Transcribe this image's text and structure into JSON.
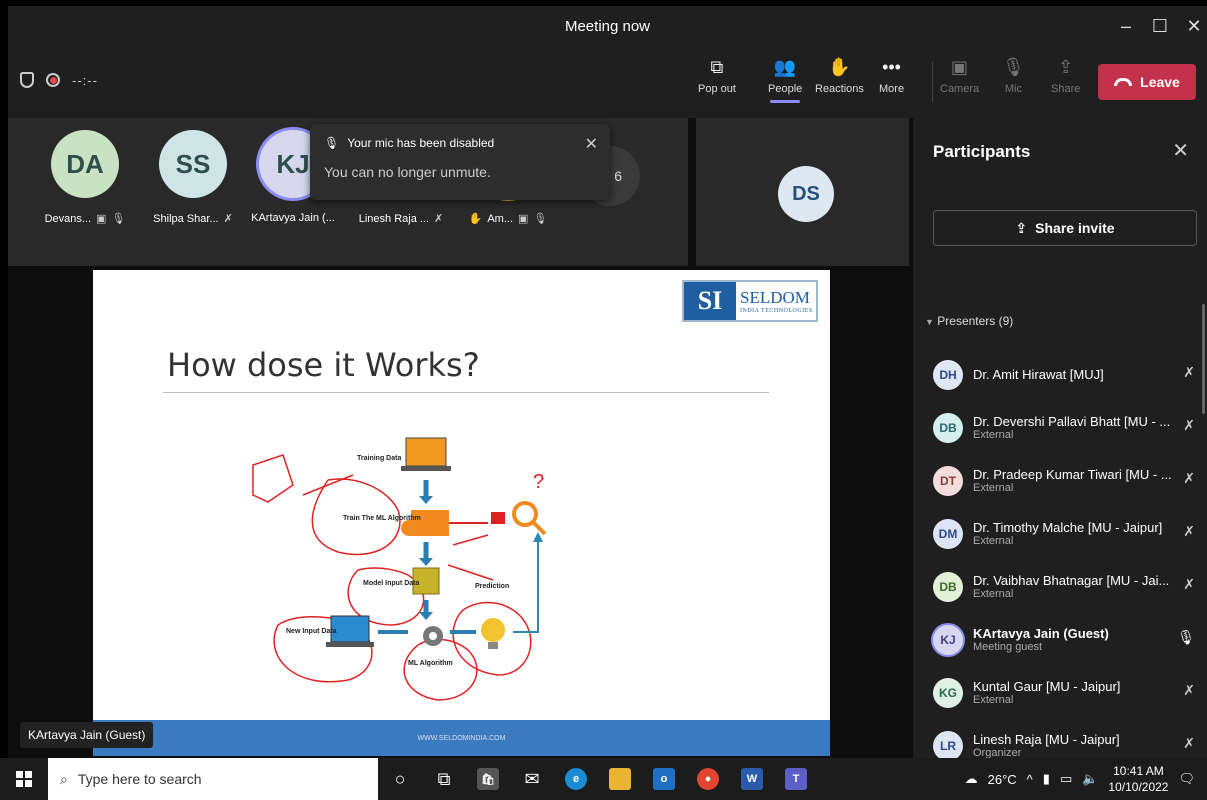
{
  "window": {
    "title": "Meeting now"
  },
  "toolbar": {
    "timer": "--:--",
    "popout": "Pop out",
    "people": "People",
    "reactions": "Reactions",
    "more": "More",
    "camera": "Camera",
    "mic": "Mic",
    "share": "Share",
    "leave": "Leave"
  },
  "toast": {
    "title": "Your mic has been disabled",
    "message": "You can no longer unmute."
  },
  "gallery": {
    "tiles": [
      {
        "initials": "DA",
        "name": "Devans...",
        "color": "#c9e2c2"
      },
      {
        "initials": "SS",
        "name": "Shilpa Shar...",
        "color": "#cfe5e5"
      },
      {
        "initials": "KJ",
        "name": "KArtavya Jain (...",
        "color": "#d7d8f0"
      },
      {
        "initials": "",
        "name": "Linesh Raja ...",
        "color": "#d9e3ee"
      },
      {
        "initials": "",
        "name": "Am...",
        "color": "#f3d89a"
      }
    ],
    "overflow": "6",
    "featured": {
      "initials": "DS"
    }
  },
  "slide": {
    "logo_mark": "SI",
    "logo_name": "SELDOM",
    "logo_sub": "INDIA TECHNOLOGIES",
    "heading": "How dose it Works?",
    "diagram": {
      "training_data": "Training Data",
      "train_ml": "Train The ML Algorithm",
      "model_input": "Model Input Data",
      "prediction": "Prediction",
      "new_input": "New Input Data",
      "ml_algorithm": "ML Algorithm",
      "question": "?"
    },
    "footer": "WWW.SELDOMINDIA.COM"
  },
  "speaker_label": "KArtavya Jain (Guest)",
  "panel": {
    "title": "Participants",
    "share_invite": "Share invite",
    "presenters_label": "Presenters (9)",
    "participants": [
      {
        "initials": "DH",
        "name": "Dr. Amit Hirawat [MUJ]",
        "sub": "",
        "bg": "#dfe6f5",
        "fg": "#2b4b8c",
        "mic": "muted"
      },
      {
        "initials": "DB",
        "name": "Dr. Devershi Pallavi Bhatt [MU - ...",
        "sub": "External",
        "bg": "#d5eeee",
        "fg": "#2a6a6a",
        "mic": "muted"
      },
      {
        "initials": "DT",
        "name": "Dr. Pradeep Kumar Tiwari [MU - ...",
        "sub": "External",
        "bg": "#f2dcdc",
        "fg": "#8a3a3a",
        "mic": "muted"
      },
      {
        "initials": "DM",
        "name": "Dr. Timothy Malche [MU - Jaipur]",
        "sub": "External",
        "bg": "#dde4f6",
        "fg": "#2b4b8c",
        "mic": "muted"
      },
      {
        "initials": "DB",
        "name": "Dr. Vaibhav Bhatnagar [MU - Jai...",
        "sub": "External",
        "bg": "#e2efd9",
        "fg": "#3d6a2a",
        "mic": "muted"
      },
      {
        "initials": "KJ",
        "name": "KArtavya Jain (Guest)",
        "sub": "Meeting guest",
        "bg": "#d7d8f0",
        "fg": "#3b3d8a",
        "mic": "on"
      },
      {
        "initials": "KG",
        "name": "Kuntal Gaur [MU - Jaipur]",
        "sub": "External",
        "bg": "#dff0e4",
        "fg": "#2a6a4a",
        "mic": "muted"
      },
      {
        "initials": "LR",
        "name": "Linesh Raja [MU - Jaipur]",
        "sub": "Organizer",
        "bg": "#dde7f3",
        "fg": "#2b4b8c",
        "mic": "muted"
      }
    ]
  },
  "taskbar": {
    "search_placeholder": "Type here to search",
    "temperature": "26°C",
    "time": "10:41 AM",
    "date": "10/10/2022"
  }
}
